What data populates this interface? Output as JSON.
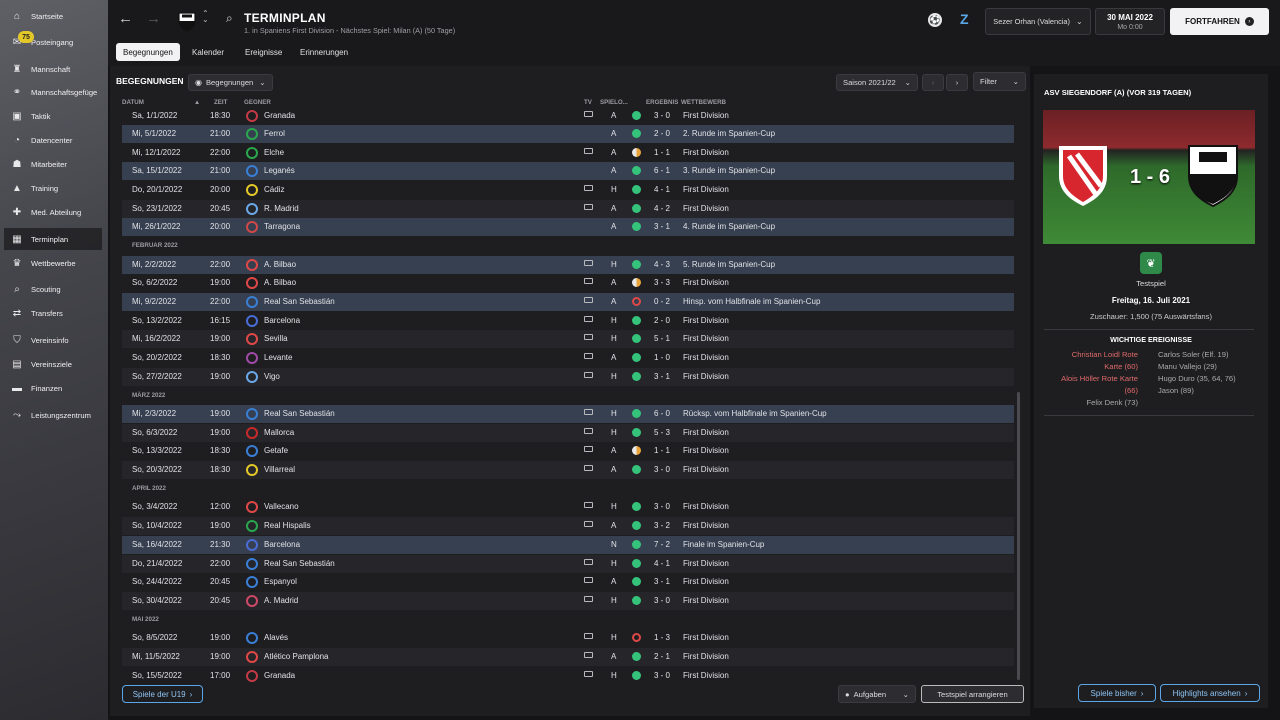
{
  "sidebar": {
    "items": [
      {
        "label": "Startseite",
        "icon": "home-icon"
      },
      {
        "label": "Posteingang",
        "icon": "inbox-icon",
        "badge": "75"
      },
      {
        "label": "Mannschaft",
        "icon": "shirt-icon"
      },
      {
        "label": "Mannschaftsgefüge",
        "icon": "dynamics-icon"
      },
      {
        "label": "Taktik",
        "icon": "tactics-icon"
      },
      {
        "label": "Datencenter",
        "icon": "data-icon"
      },
      {
        "label": "Mitarbeiter",
        "icon": "staff-icon"
      },
      {
        "label": "Training",
        "icon": "training-icon"
      },
      {
        "label": "Med. Abteilung",
        "icon": "medical-icon"
      },
      {
        "label": "Terminplan",
        "icon": "calendar-icon",
        "active": true
      },
      {
        "label": "Wettbewerbe",
        "icon": "trophy-icon"
      },
      {
        "label": "Scouting",
        "icon": "scouting-icon"
      },
      {
        "label": "Transfers",
        "icon": "transfer-icon"
      },
      {
        "label": "Vereinsinfo",
        "icon": "club-icon"
      },
      {
        "label": "Vereinsziele",
        "icon": "goals-icon"
      },
      {
        "label": "Finanzen",
        "icon": "finance-icon"
      },
      {
        "label": "Leistungszentrum",
        "icon": "performance-icon"
      }
    ]
  },
  "header": {
    "title": "TERMINPLAN",
    "subtitle": "1. in Spaniens First Division - Nächstes Spiel: Milan (A) (50 Tage)",
    "manager": "Sezer Orhan (Valencia)",
    "date": "30 MAI 2022",
    "day_time": "Mo 0:00",
    "continue_label": "FORTFAHREN"
  },
  "tabs": [
    "Begegnungen",
    "Kalender",
    "Ereignisse",
    "Erinnerungen"
  ],
  "toolbar": {
    "section": "BEGEGNUNGEN",
    "view_dropdown": "Begegnungen",
    "season": "Saison 2021/22",
    "filter": "Filter"
  },
  "columns": {
    "datum": "DATUM",
    "zeit": "ZEIT",
    "gegner": "GEGNER",
    "tv": "TV",
    "spielort": "SPIELO...",
    "ergebnis": "ERGEBNIS",
    "wettbewerb": "WETTBEWERB"
  },
  "months": {
    "feb": "FEBRUAR 2022",
    "mar": "MÄRZ 2022",
    "apr": "APRIL 2022",
    "may": "MAI 2022"
  },
  "fixtures": [
    {
      "date": "Sa, 1/1/2022",
      "time": "18:30",
      "opp": "Granada",
      "tv": true,
      "venue": "A",
      "res": "w",
      "score": "3 - 0",
      "comp": "First Division",
      "crest": "#c23a46"
    },
    {
      "date": "Mi, 5/1/2022",
      "time": "21:00",
      "opp": "Ferrol",
      "tv": false,
      "venue": "A",
      "res": "w",
      "score": "2 - 0",
      "comp": "2. Runde im Spanien-Cup",
      "crest": "#2aa84e",
      "hl": true
    },
    {
      "date": "Mi, 12/1/2022",
      "time": "22:00",
      "opp": "Elche",
      "tv": true,
      "venue": "A",
      "res": "d",
      "score": "1 - 1",
      "comp": "First Division",
      "crest": "#2aa84e"
    },
    {
      "date": "Sa, 15/1/2022",
      "time": "21:00",
      "opp": "Leganés",
      "tv": false,
      "venue": "A",
      "res": "w",
      "score": "6 - 1",
      "comp": "3. Runde im Spanien-Cup",
      "crest": "#3a7fd6",
      "hl": true
    },
    {
      "date": "Do, 20/1/2022",
      "time": "20:00",
      "opp": "Cádiz",
      "tv": true,
      "venue": "H",
      "res": "w",
      "score": "4 - 1",
      "comp": "First Division",
      "crest": "#e4c82a"
    },
    {
      "date": "So, 23/1/2022",
      "time": "20:45",
      "opp": "R. Madrid",
      "tv": true,
      "venue": "A",
      "res": "w",
      "score": "4 - 2",
      "comp": "First Division",
      "crest": "#6aa8e8"
    },
    {
      "date": "Mi, 26/1/2022",
      "time": "20:00",
      "opp": "Tarragona",
      "tv": false,
      "venue": "A",
      "res": "w",
      "score": "3 - 1",
      "comp": "4. Runde im Spanien-Cup",
      "crest": "#d04848",
      "hl": true
    },
    {
      "date": "Mi, 2/2/2022",
      "time": "22:00",
      "opp": "A. Bilbao",
      "tv": true,
      "venue": "H",
      "res": "w",
      "score": "4 - 3",
      "comp": "5. Runde im Spanien-Cup",
      "crest": "#e04848",
      "hl": true
    },
    {
      "date": "So, 6/2/2022",
      "time": "19:00",
      "opp": "A. Bilbao",
      "tv": true,
      "venue": "A",
      "res": "d",
      "score": "3 - 3",
      "comp": "First Division",
      "crest": "#e04848"
    },
    {
      "date": "Mi, 9/2/2022",
      "time": "22:00",
      "opp": "Real San Sebastián",
      "tv": true,
      "venue": "A",
      "res": "l",
      "score": "0 - 2",
      "comp": "Hinsp. vom Halbfinale im Spanien-Cup",
      "crest": "#3a7fd6",
      "hl": true
    },
    {
      "date": "So, 13/2/2022",
      "time": "16:15",
      "opp": "Barcelona",
      "tv": true,
      "venue": "H",
      "res": "w",
      "score": "2 - 0",
      "comp": "First Division",
      "crest": "#4a6cd6"
    },
    {
      "date": "Mi, 16/2/2022",
      "time": "19:00",
      "opp": "Sevilla",
      "tv": true,
      "venue": "H",
      "res": "w",
      "score": "5 - 1",
      "comp": "First Division",
      "crest": "#e04848"
    },
    {
      "date": "So, 20/2/2022",
      "time": "18:30",
      "opp": "Levante",
      "tv": true,
      "venue": "A",
      "res": "w",
      "score": "1 - 0",
      "comp": "First Division",
      "crest": "#a04aa8"
    },
    {
      "date": "So, 27/2/2022",
      "time": "19:00",
      "opp": "Vigo",
      "tv": true,
      "venue": "H",
      "res": "w",
      "score": "3 - 1",
      "comp": "First Division",
      "crest": "#6aa8e8"
    },
    {
      "date": "Mi, 2/3/2022",
      "time": "19:00",
      "opp": "Real San Sebastián",
      "tv": true,
      "venue": "H",
      "res": "w",
      "score": "6 - 0",
      "comp": "Rücksp. vom Halbfinale im Spanien-Cup",
      "crest": "#3a7fd6",
      "hl": true
    },
    {
      "date": "So, 6/3/2022",
      "time": "19:00",
      "opp": "Mallorca",
      "tv": true,
      "venue": "H",
      "res": "w",
      "score": "5 - 3",
      "comp": "First Division",
      "crest": "#c82a2a"
    },
    {
      "date": "So, 13/3/2022",
      "time": "18:30",
      "opp": "Getafe",
      "tv": true,
      "venue": "A",
      "res": "d",
      "score": "1 - 1",
      "comp": "First Division",
      "crest": "#3a7fd6"
    },
    {
      "date": "So, 20/3/2022",
      "time": "18:30",
      "opp": "Villarreal",
      "tv": true,
      "venue": "A",
      "res": "w",
      "score": "3 - 0",
      "comp": "First Division",
      "crest": "#e4c82a"
    },
    {
      "date": "So, 3/4/2022",
      "time": "12:00",
      "opp": "Vallecano",
      "tv": true,
      "venue": "H",
      "res": "w",
      "score": "3 - 0",
      "comp": "First Division",
      "crest": "#e04848"
    },
    {
      "date": "So, 10/4/2022",
      "time": "19:00",
      "opp": "Real Hispalis",
      "tv": true,
      "venue": "A",
      "res": "w",
      "score": "3 - 2",
      "comp": "First Division",
      "crest": "#2aa84e"
    },
    {
      "date": "Sa, 16/4/2022",
      "time": "21:30",
      "opp": "Barcelona",
      "tv": false,
      "venue": "N",
      "res": "w",
      "score": "7 - 2",
      "comp": "Finale im Spanien-Cup",
      "crest": "#4a6cd6",
      "hl": true
    },
    {
      "date": "Do, 21/4/2022",
      "time": "22:00",
      "opp": "Real San Sebastián",
      "tv": true,
      "venue": "H",
      "res": "w",
      "score": "4 - 1",
      "comp": "First Division",
      "crest": "#3a7fd6"
    },
    {
      "date": "So, 24/4/2022",
      "time": "20:45",
      "opp": "Espanyol",
      "tv": true,
      "venue": "A",
      "res": "w",
      "score": "3 - 1",
      "comp": "First Division",
      "crest": "#3a7fd6"
    },
    {
      "date": "So, 30/4/2022",
      "time": "20:45",
      "opp": "A. Madrid",
      "tv": true,
      "venue": "H",
      "res": "w",
      "score": "3 - 0",
      "comp": "First Division",
      "crest": "#d04868"
    },
    {
      "date": "So, 8/5/2022",
      "time": "19:00",
      "opp": "Alavés",
      "tv": true,
      "venue": "H",
      "res": "l",
      "score": "1 - 3",
      "comp": "First Division",
      "crest": "#3a7fd6"
    },
    {
      "date": "Mi, 11/5/2022",
      "time": "19:00",
      "opp": "Atlético Pamplona",
      "tv": true,
      "venue": "A",
      "res": "w",
      "score": "2 - 1",
      "comp": "First Division",
      "crest": "#e04848"
    },
    {
      "date": "So, 15/5/2022",
      "time": "17:00",
      "opp": "Granada",
      "tv": true,
      "venue": "H",
      "res": "w",
      "score": "3 - 0",
      "comp": "First Division",
      "crest": "#c23a46"
    }
  ],
  "bottom": {
    "u19_btn": "Spiele der U19",
    "tasks": "Aufgaben",
    "arrange": "Testspiel arrangieren"
  },
  "panel": {
    "title": "ASV SIEGENDORF (A) (VOR 319 TAGEN)",
    "score": "1 - 6",
    "competition": "Testspiel",
    "date": "Freitag, 16. Juli 2021",
    "spectators": "Zuschauer: 1,500 (75 Auswärtsfans)",
    "events_title": "WICHTIGE EREIGNISSE",
    "home_events": [
      "Christian Loidl Rote",
      "Karte (60)",
      "Alois Höller Rote Karte",
      "(66)",
      "Felix Denk (73)"
    ],
    "away_events": [
      "Carlos Soler (Elf. 19)",
      "Manu Vallejo (29)",
      "Hugo Duro (35, 64, 76)",
      "Jason (89)"
    ],
    "btn_prev": "Spiele bisher",
    "btn_high": "Highlights ansehen"
  },
  "colors": {
    "win": "#35c27a",
    "draw": "#e8a43a",
    "loss": "#e04848",
    "accent": "#5aa6e6"
  }
}
